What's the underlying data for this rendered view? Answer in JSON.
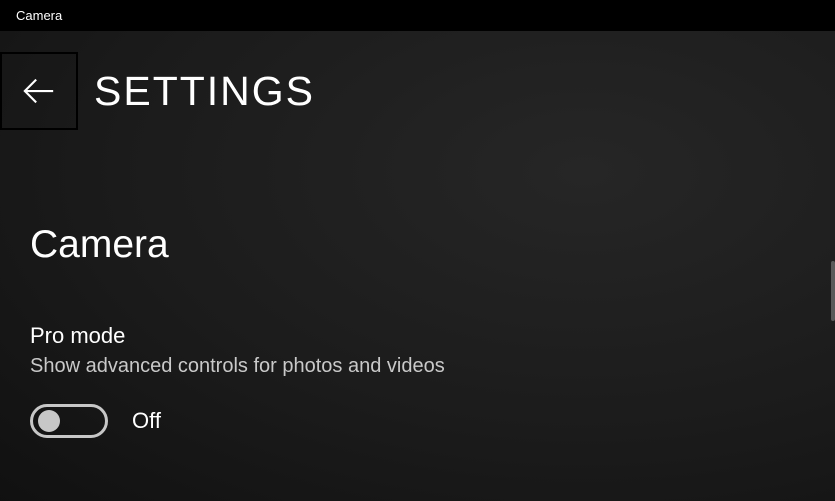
{
  "titlebar": {
    "app_name": "Camera"
  },
  "header": {
    "page_title": "SETTINGS"
  },
  "section": {
    "heading": "Camera"
  },
  "setting": {
    "pro_mode": {
      "label": "Pro mode",
      "description": "Show advanced controls for photos and videos",
      "state": "Off",
      "enabled": false
    }
  }
}
